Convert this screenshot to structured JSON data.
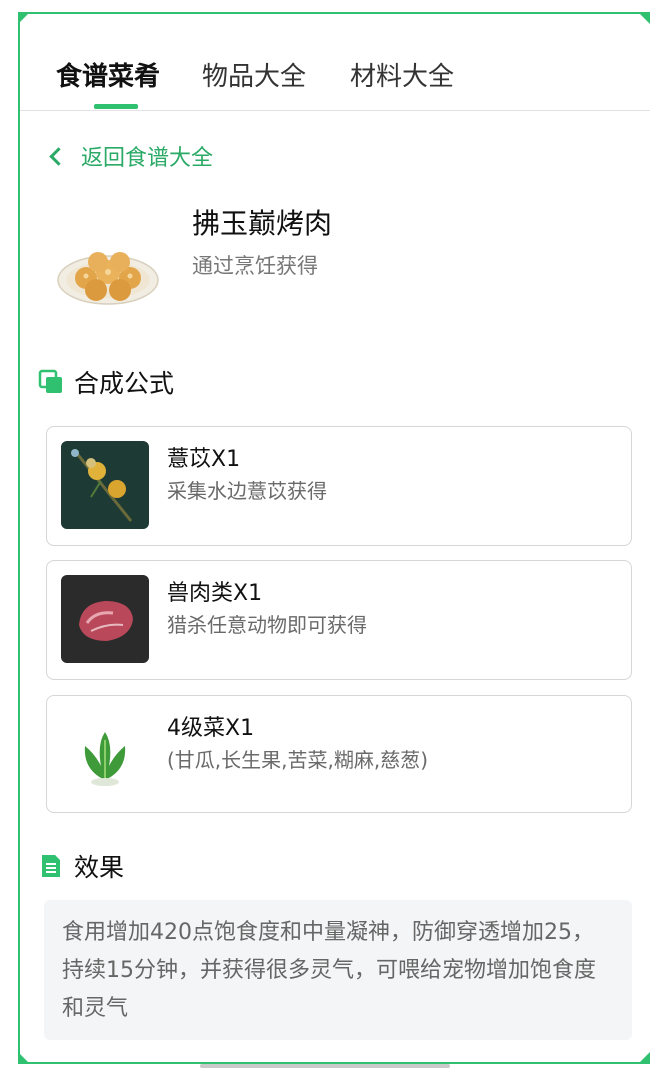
{
  "tabs": [
    {
      "label": "食谱菜肴",
      "active": true
    },
    {
      "label": "物品大全",
      "active": false
    },
    {
      "label": "材料大全",
      "active": false
    }
  ],
  "back": {
    "label": "返回食谱大全"
  },
  "dish": {
    "title": "拂玉巅烤肉",
    "subtitle": "通过烹饪获得",
    "image_icon": "roasted-buns-plate-image"
  },
  "formula": {
    "heading": "合成公式",
    "icon": "stack-icon",
    "items": [
      {
        "name": "薏苡X1",
        "desc": "采集水边薏苡获得",
        "image_icon": "yiyi-plant-image"
      },
      {
        "name": "兽肉类X1",
        "desc": "猎杀任意动物即可获得",
        "image_icon": "raw-meat-image"
      },
      {
        "name": "4级菜X1",
        "desc": "(甘瓜,长生果,苦菜,糊麻,慈葱)",
        "image_icon": "green-vegetable-image"
      }
    ]
  },
  "effect": {
    "heading": "效果",
    "icon": "document-icon",
    "text": "食用增加420点饱食度和中量凝神，防御穿透增加25，持续15分钟，并获得很多灵气，可喂给宠物增加饱食度和灵气"
  },
  "colors": {
    "accent": "#2fc070",
    "accent_text": "#2aaa66"
  }
}
